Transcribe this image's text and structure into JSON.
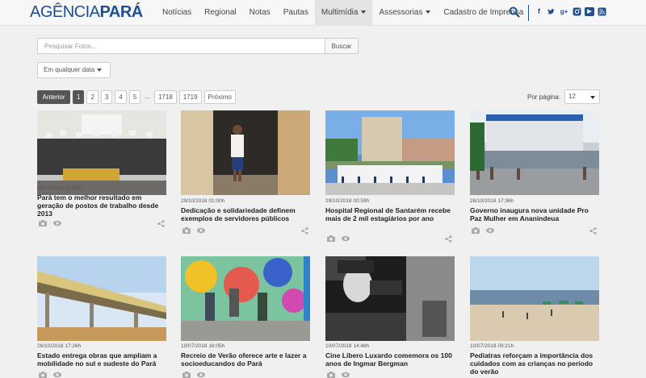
{
  "header": {
    "logo_part1": "AGÊNCIA",
    "logo_part2": "PARÁ",
    "nav": [
      {
        "label": "Notícias",
        "caret": false,
        "active": false
      },
      {
        "label": "Regional",
        "caret": false,
        "active": false
      },
      {
        "label": "Notas",
        "caret": false,
        "active": false
      },
      {
        "label": "Pautas",
        "caret": false,
        "active": false
      },
      {
        "label": "Multimídia",
        "caret": true,
        "active": true
      },
      {
        "label": "Assessorias",
        "caret": true,
        "active": false
      },
      {
        "label": "Cadastro de Imprensa",
        "caret": false,
        "active": false
      }
    ],
    "social": [
      "facebook-icon",
      "twitter-icon",
      "google-plus-icon",
      "instagram-icon",
      "youtube-icon",
      "rss-icon"
    ],
    "brand_color": "#1d4f91"
  },
  "search": {
    "placeholder": "Pesquisar Fotos...",
    "value": "",
    "button_label": "Buscar"
  },
  "date_filter": {
    "label": "Em qualquer data"
  },
  "pagination": {
    "prev_label": "Anterior",
    "pages": [
      "1",
      "2",
      "3",
      "4",
      "5"
    ],
    "ellipsis": "...",
    "last_pages": [
      "1718",
      "1719"
    ],
    "next_label": "Próximo",
    "current": "1"
  },
  "per_page": {
    "label": "Por página:",
    "value": "12"
  },
  "cards": [
    {
      "date": "29/10/2018 01:00h",
      "title": "Pará tem o melhor resultado em geração de postos de trabalho desde 2013"
    },
    {
      "date": "29/10/2018 01:00h",
      "title": "Dedicação e solidariedade definem exemplos de servidores públicos"
    },
    {
      "date": "29/10/2018 00:59h",
      "title": "Hospital Regional de Santarém recebe mais de 2 mil estagiários por ano"
    },
    {
      "date": "26/10/2018 17:36h",
      "title": "Governo inaugura nova unidade Pro Paz Mulher em Ananindeua"
    },
    {
      "date": "26/10/2018 17:26h",
      "title": "Estado entrega obras que ampliam a mobilidade no sul e sudeste do Pará"
    },
    {
      "date": "10/07/2018 16:05h",
      "title": "Recreio de Verão oferece arte e lazer a socioeducandos do Pará"
    },
    {
      "date": "10/07/2018 14:48h",
      "title": "Cine Líbero Luxardo comemora os 100 anos de Ingmar Bergman"
    },
    {
      "date": "10/07/2018 09:21h",
      "title": "Pediatras reforçam a importância dos cuidados com as crianças no período do verão"
    }
  ]
}
